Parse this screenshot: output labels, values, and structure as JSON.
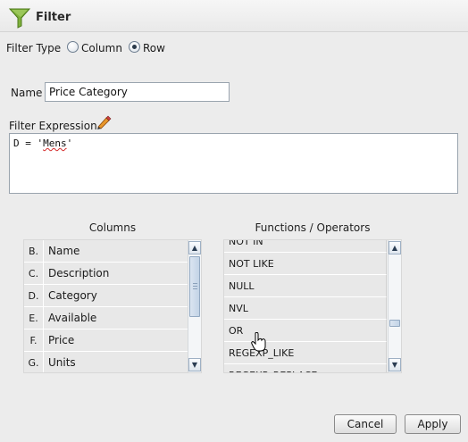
{
  "header": {
    "title": "Filter",
    "icon": "funnel-icon"
  },
  "filter_type": {
    "label": "Filter Type",
    "options": [
      "Column",
      "Row"
    ],
    "selected": "Row"
  },
  "name": {
    "label": "Name",
    "value": "Price Category"
  },
  "expression": {
    "label": "Filter Expression",
    "value_prefix": "D = '",
    "value_word": "Mens",
    "value_suffix": "'"
  },
  "columns": {
    "title": "Columns",
    "items": [
      {
        "letter": "B.",
        "name": "Name"
      },
      {
        "letter": "C.",
        "name": "Description"
      },
      {
        "letter": "D.",
        "name": "Category"
      },
      {
        "letter": "E.",
        "name": "Available"
      },
      {
        "letter": "F.",
        "name": "Price"
      },
      {
        "letter": "G.",
        "name": "Units"
      }
    ]
  },
  "functions": {
    "title": "Functions / Operators",
    "items": [
      "NOT IN",
      "NOT LIKE",
      "NULL",
      "NVL",
      "OR",
      "REGEXP_LIKE",
      "REGEXP_REPLACE"
    ]
  },
  "buttons": {
    "cancel": "Cancel",
    "apply": "Apply"
  },
  "colors": {
    "accent": "#5a8a1e",
    "squiggle": "#d42a2a"
  }
}
